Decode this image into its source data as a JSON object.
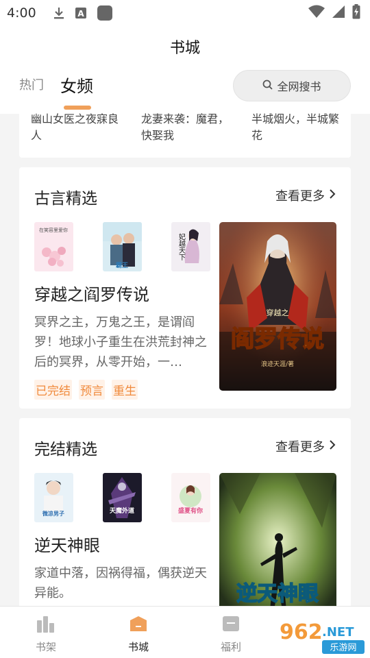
{
  "status_bar": {
    "time": "4:00",
    "icons": [
      "download-icon",
      "a-notification-icon",
      "app-square-icon",
      "wifi-icon",
      "signal-icon",
      "battery-icon"
    ]
  },
  "header": {
    "title": "书城",
    "tabs": [
      {
        "label": "热门",
        "active": false
      },
      {
        "label": "女频",
        "active": true
      }
    ],
    "search_label": "全网搜书",
    "accent_color": "#f0a05a"
  },
  "top_list": [
    {
      "title": "幽山女医之夜寐良人"
    },
    {
      "title": "龙妻来袭：魔君，快娶我"
    },
    {
      "title": "半城烟火，半城繁花"
    }
  ],
  "sections": [
    {
      "title": "古言精选",
      "see_more": "查看更多",
      "featured": {
        "title": "穿越之阎罗传说",
        "desc": "冥界之主，万鬼之王，是谓阎罗！地球小子重生在洪荒封神之后的冥界，从零开始，一…",
        "tags": [
          "已完结",
          "预言",
          "重生"
        ],
        "cover_title": "阎罗传说",
        "cover_prefix": "穿越之",
        "cover_author": "浪迹天涯/著"
      },
      "mini_covers": [
        {
          "text": "在笑容里爱你"
        },
        {
          "text": "霸王"
        },
        {
          "text": "妃越天下"
        }
      ]
    },
    {
      "title": "完结精选",
      "see_more": "查看更多",
      "featured": {
        "title": "逆天神眼",
        "desc": "家道中落，因祸得福，偶获逆天异能。",
        "cover_title": "逆天神眼"
      },
      "mini_covers": [
        {
          "text": "微凉男子"
        },
        {
          "text": "天魔外道"
        },
        {
          "text": "盛夏有你"
        }
      ]
    }
  ],
  "bottom_nav": [
    {
      "label": "书架",
      "active": false
    },
    {
      "label": "书城",
      "active": true
    },
    {
      "label": "福利",
      "active": false
    }
  ],
  "watermark": {
    "number": "962",
    "suffix": ".NET",
    "sub": "乐游网"
  }
}
